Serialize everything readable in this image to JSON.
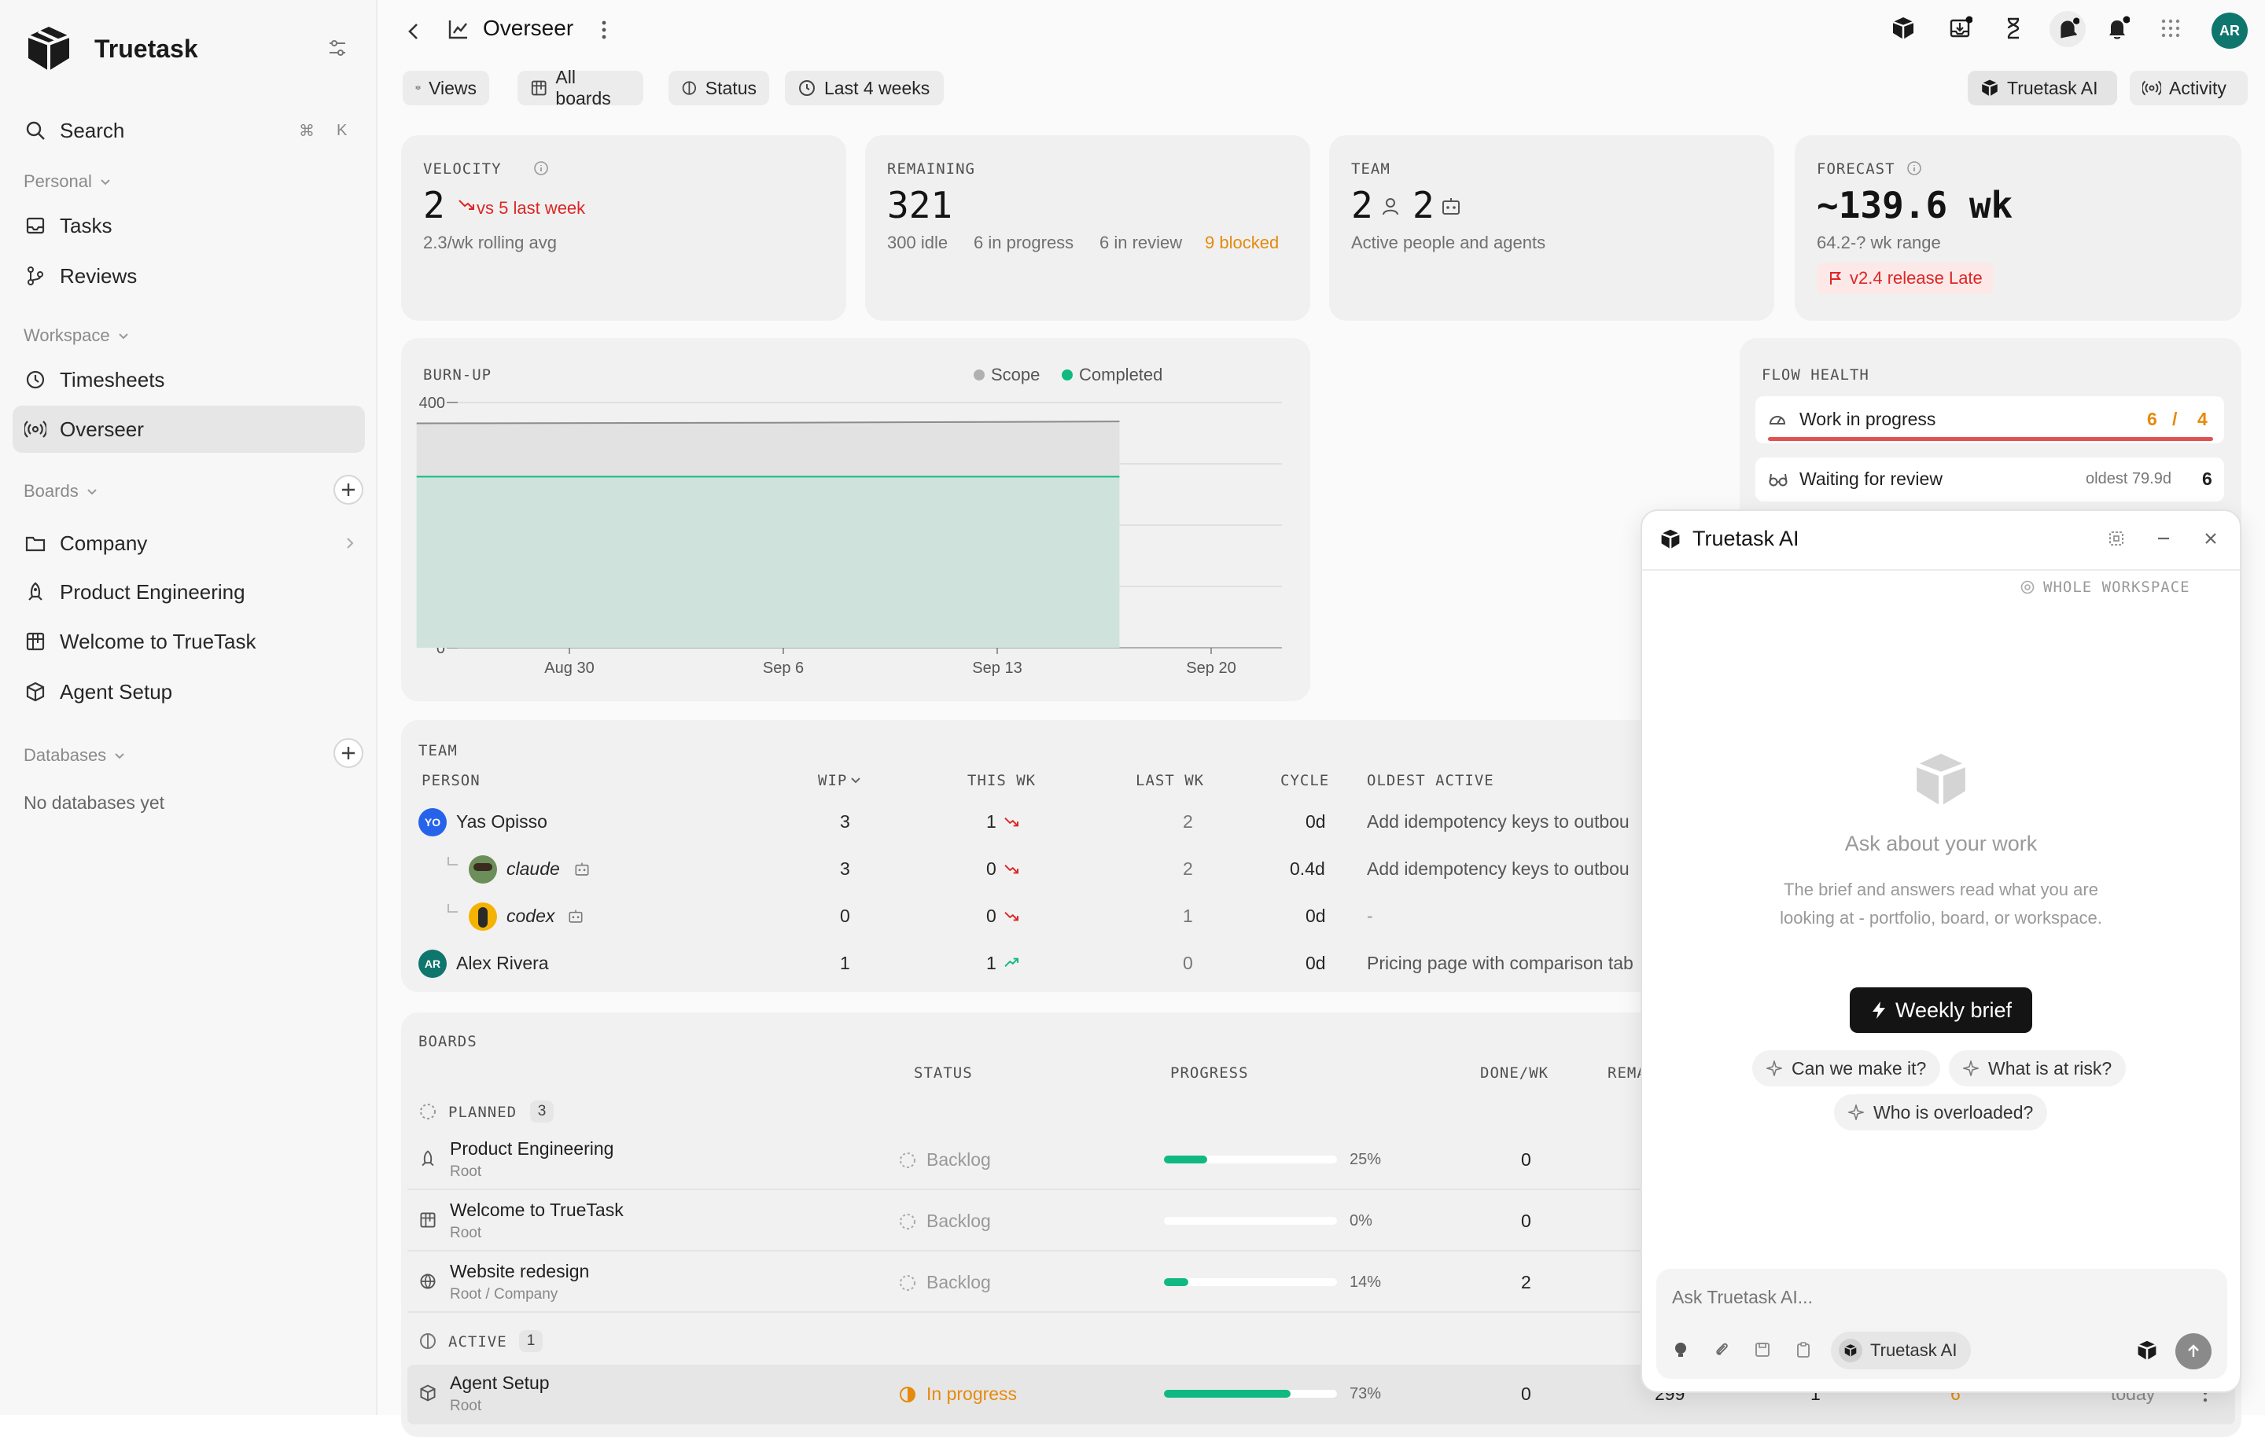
{
  "sidebar": {
    "brand": "Truetask",
    "search": {
      "label": "Search",
      "shortcut_cmd": "⌘",
      "shortcut_key": "K"
    },
    "personal_label": "Personal",
    "personal_items": [
      {
        "label": "Tasks",
        "icon": "inbox-icon"
      },
      {
        "label": "Reviews",
        "icon": "git-branch-icon"
      }
    ],
    "workspace_label": "Workspace",
    "workspace_items": [
      {
        "label": "Timesheets",
        "icon": "clock-icon"
      },
      {
        "label": "Overseer",
        "icon": "broadcast-icon"
      }
    ],
    "boards_label": "Boards",
    "board_items": [
      {
        "label": "Company",
        "icon": "folder-icon"
      },
      {
        "label": "Product Engineering",
        "icon": "rocket-icon"
      },
      {
        "label": "Welcome to TrueTask",
        "icon": "board-icon"
      },
      {
        "label": "Agent Setup",
        "icon": "package-icon"
      }
    ],
    "databases_label": "Databases",
    "databases_empty": "No databases yet"
  },
  "header": {
    "title": "Overseer",
    "avatar_initials": "AR"
  },
  "filters": [
    {
      "label": "Views"
    },
    {
      "label": "All boards"
    },
    {
      "label": "Status"
    },
    {
      "label": "Last 4 weeks"
    }
  ],
  "right_actions": {
    "ai": "Truetask AI",
    "activity": "Activity"
  },
  "stats": {
    "velocity": {
      "label": "VELOCITY",
      "value": "2",
      "delta": "vs 5 last week",
      "sub": "2.3/wk rolling avg"
    },
    "remaining": {
      "label": "REMAINING",
      "value": "321",
      "idle": "300 idle",
      "in_progress": "6 in progress",
      "in_review": "6 in review",
      "blocked": "9 blocked"
    },
    "team": {
      "label": "TEAM",
      "people": "2",
      "agents": "2",
      "sub": "Active people and agents"
    },
    "forecast": {
      "label": "FORECAST",
      "value": "~139.6 wk",
      "sub": "64.2-? wk range",
      "badge": "v2.4 release Late"
    }
  },
  "chart_data": {
    "type": "area",
    "title": "BURN-UP",
    "x_ticks": [
      "Aug 30",
      "Sep 6",
      "Sep 13",
      "Sep 20"
    ],
    "y_ticks": [
      "0",
      "100",
      "200",
      "300",
      "400"
    ],
    "ylim": [
      0,
      400
    ],
    "series": [
      {
        "name": "Scope",
        "color": "#b8b8b8",
        "x": [
          "Aug 25",
          "Sep 17"
        ],
        "values": [
          366,
          369
        ]
      },
      {
        "name": "Completed",
        "color": "#10b981",
        "x": [
          "Aug 25",
          "Sep 17"
        ],
        "values": [
          279,
          279
        ]
      }
    ],
    "legend": "top-right",
    "grid": true
  },
  "flow_health": {
    "label": "FLOW HEALTH",
    "wip": {
      "label": "Work in progress",
      "value": "6",
      "sep": "/",
      "limit": "4"
    },
    "review": {
      "label": "Waiting for review",
      "oldest": "oldest 79.9d",
      "count": "6"
    }
  },
  "team_table": {
    "label": "TEAM",
    "headers": {
      "person": "PERSON",
      "wip": "WIP",
      "this_wk": "THIS WK",
      "last_wk": "LAST WK",
      "cycle": "CYCLE",
      "oldest": "OLDEST ACTIVE"
    },
    "rows": [
      {
        "initials": "YO",
        "name": "Yas Opisso",
        "wip": "3",
        "this_wk": "1",
        "last_wk": "2",
        "cycle": "0d",
        "oldest": "Add idempotency keys to outbou",
        "trend": "down"
      },
      {
        "name": "claude",
        "wip": "3",
        "this_wk": "0",
        "last_wk": "2",
        "cycle": "0.4d",
        "oldest": "Add idempotency keys to outbou",
        "trend": "down"
      },
      {
        "name": "codex",
        "wip": "0",
        "this_wk": "0",
        "last_wk": "1",
        "cycle": "0d",
        "oldest": "-",
        "trend": "down"
      },
      {
        "initials": "AR",
        "name": "Alex Rivera",
        "wip": "1",
        "this_wk": "1",
        "last_wk": "0",
        "cycle": "0d",
        "oldest": "Pricing page with comparison tab",
        "trend": "up"
      }
    ]
  },
  "boards_table": {
    "label": "BOARDS",
    "headers": {
      "status": "STATUS",
      "progress": "PROGRESS",
      "done": "DONE/WK",
      "remaining": "REMA"
    },
    "planned": {
      "label": "PLANNED",
      "count": "3"
    },
    "active": {
      "label": "ACTIVE",
      "count": "1"
    },
    "rows": [
      {
        "name": "Product Engineering",
        "path": "Root",
        "status": "Backlog",
        "progress": 0.25,
        "pct": "25%",
        "done": "0"
      },
      {
        "name": "Welcome to TrueTask",
        "path": "Root",
        "status": "Backlog",
        "progress": 0.0,
        "pct": "0%",
        "done": "0"
      },
      {
        "name": "Website redesign",
        "path": "Root / Company",
        "status": "Backlog",
        "progress": 0.14,
        "pct": "14%",
        "done": "2"
      }
    ],
    "active_row": {
      "name": "Agent Setup",
      "path": "Root",
      "status": "In progress",
      "progress": 0.73,
      "pct": "73%",
      "done": "0",
      "remaining": "299",
      "c1": "1",
      "c2": "6",
      "updated": "today"
    }
  },
  "ai_panel": {
    "title": "Truetask AI",
    "scope": "WHOLE WORKSPACE",
    "heading": "Ask about your work",
    "description": "The brief and answers read what you are looking at - portfolio, board, or workspace.",
    "primary": "Weekly brief",
    "suggestions": [
      "Can we make it?",
      "What is at risk?",
      "Who is overloaded?"
    ],
    "input_placeholder": "Ask Truetask AI...",
    "model": "Truetask AI"
  },
  "colors": {
    "accent_green": "#10b981",
    "danger": "#dc2626",
    "warn": "#e58a0c",
    "avatar_blue": "#2563eb",
    "avatar_teal": "#0f766e"
  }
}
